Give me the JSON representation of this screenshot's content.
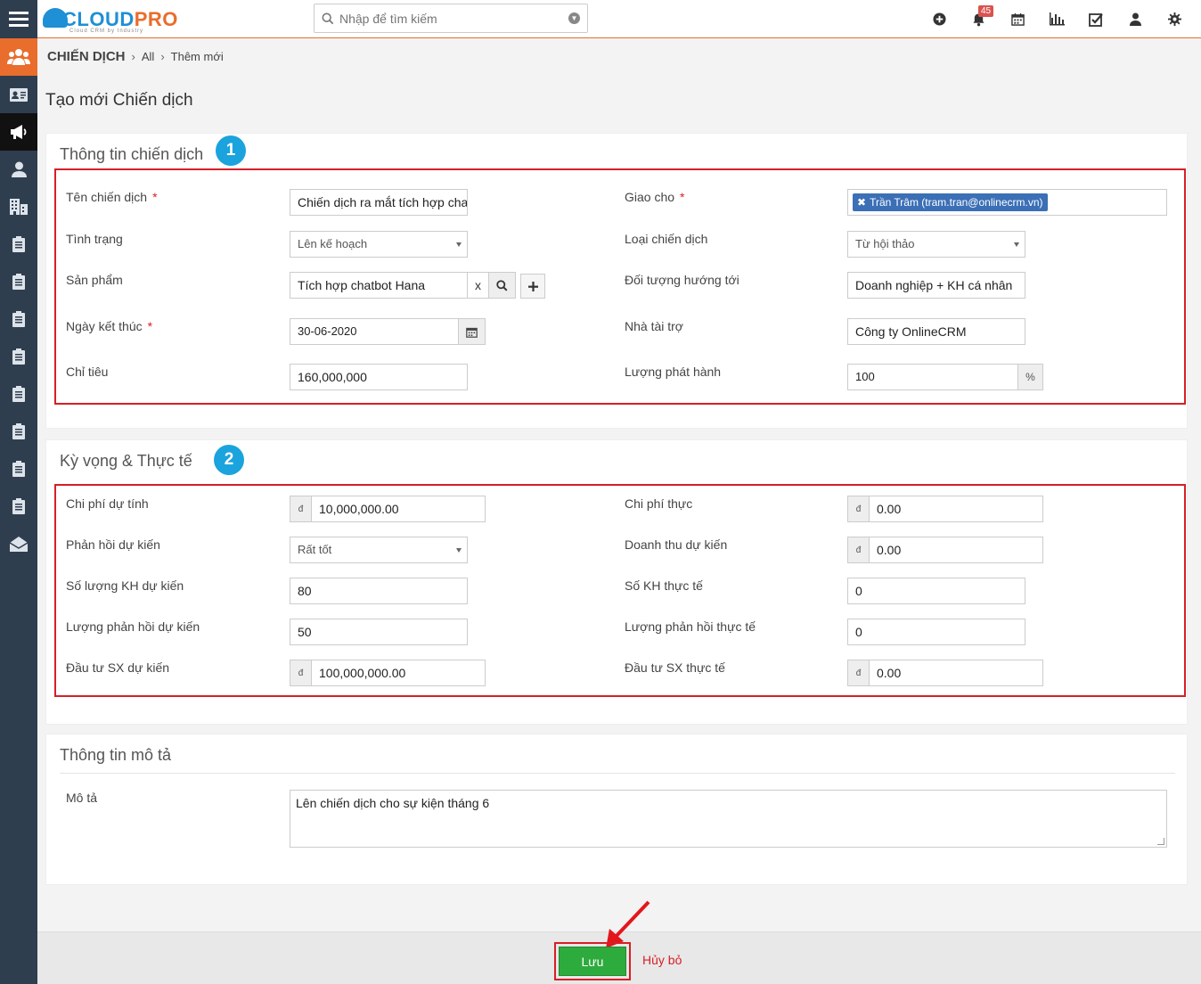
{
  "header": {
    "logo_part1": "CLOUD",
    "logo_part2": "PRO",
    "logo_tagline": "Cloud CRM by Industry",
    "search_placeholder": "Nhập để tìm kiếm",
    "notification_count": "45",
    "accent_color": "#e96d2c"
  },
  "sidebar": {
    "icons": [
      "users-icon",
      "contact-card-icon",
      "megaphone-icon",
      "user-icon",
      "building-icon",
      "document-icon",
      "document-icon",
      "document-icon",
      "document-icon",
      "document-icon",
      "document-icon",
      "document-icon",
      "document-icon",
      "mail-open-icon"
    ]
  },
  "breadcrumb": {
    "module": "CHIẾN DỊCH",
    "all": "All",
    "current": "Thêm mới"
  },
  "page_title": "Tạo mới Chiến dịch",
  "section1": {
    "title": "Thông tin chiến dịch",
    "step": "1",
    "fields": {
      "ten_chien_dich_label": "Tên chiến dịch",
      "ten_chien_dich_value": "Chiến dịch ra mắt tích hợp chatbot",
      "tinh_trang_label": "Tình trạng",
      "tinh_trang_value": "Lên kế hoạch",
      "san_pham_label": "Sản phẩm",
      "san_pham_value": "Tích hợp chatbot Hana",
      "san_pham_clear": "x",
      "ngay_ket_thuc_label": "Ngày kết thúc",
      "ngay_ket_thuc_value": "30-06-2020",
      "chi_tieu_label": "Chỉ tiêu",
      "chi_tieu_value": "160,000,000",
      "giao_cho_label": "Giao cho",
      "giao_cho_value": "Trần Trâm (tram.tran@onlinecrm.vn)",
      "loai_chien_dich_label": "Loại chiến dịch",
      "loai_chien_dich_value": "Từ hội thảo",
      "doi_tuong_label": "Đối tượng hướng tới",
      "doi_tuong_value": "Doanh nghiệp + KH cá nhân",
      "nha_tai_tro_label": "Nhà tài trợ",
      "nha_tai_tro_value": "Công ty OnlineCRM",
      "luong_phat_hanh_label": "Lượng phát hành",
      "luong_phat_hanh_value": "100",
      "luong_phat_hanh_unit": "%",
      "required_mark": "*"
    }
  },
  "section2": {
    "title": "Kỳ vọng & Thực tế",
    "step": "2",
    "currency_symbol": "đ",
    "fields": {
      "chi_phi_du_tinh_label": "Chi phí dự tính",
      "chi_phi_du_tinh_value": "10,000,000.00",
      "phan_hoi_du_kien_label": "Phản hồi dự kiến",
      "phan_hoi_du_kien_value": "Rất tốt",
      "so_luong_kh_du_kien_label": "Số lượng KH dự kiến",
      "so_luong_kh_du_kien_value": "80",
      "luong_phan_hoi_du_kien_label": "Lượng phản hồi dự kiến",
      "luong_phan_hoi_du_kien_value": "50",
      "dau_tu_sx_du_kien_label": "Đầu tư SX dự kiến",
      "dau_tu_sx_du_kien_value": "100,000,000.00",
      "chi_phi_thuc_label": "Chi phí thực",
      "chi_phi_thuc_value": "0.00",
      "doanh_thu_du_kien_label": "Doanh thu dự kiến",
      "doanh_thu_du_kien_value": "0.00",
      "so_kh_thuc_te_label": "Số KH thực tế",
      "so_kh_thuc_te_value": "0",
      "luong_phan_hoi_thuc_te_label": "Lượng phản hồi thực tế",
      "luong_phan_hoi_thuc_te_value": "0",
      "dau_tu_sx_thuc_te_label": "Đầu tư SX thực tế",
      "dau_tu_sx_thuc_te_value": "0.00"
    }
  },
  "section3": {
    "title": "Thông tin mô tả",
    "mo_ta_label": "Mô tả",
    "mo_ta_value": "Lên chiến dịch cho sự kiện tháng 6"
  },
  "footer": {
    "save_label": "Lưu",
    "cancel_label": "Hủy bỏ"
  }
}
